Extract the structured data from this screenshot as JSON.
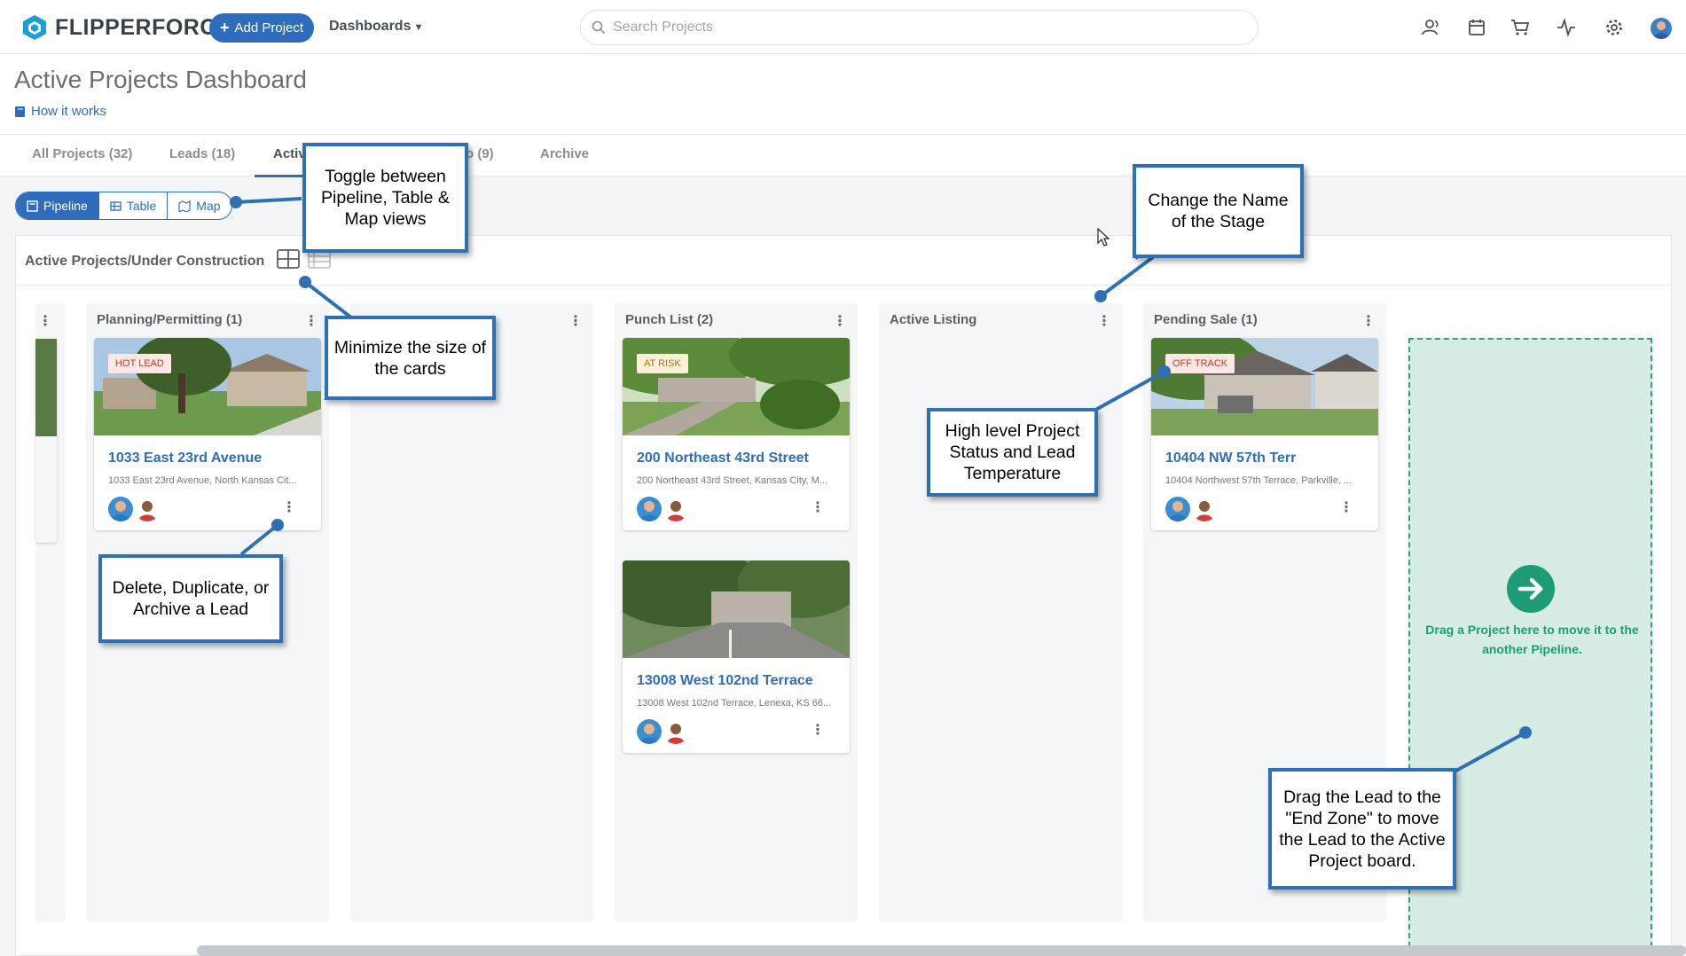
{
  "brand": {
    "name": "FLIPPERFORCE"
  },
  "nav": {
    "add_project": "Add Project",
    "dashboards": "Dashboards",
    "search_placeholder": "Search Projects"
  },
  "page": {
    "title": "Active Projects Dashboard",
    "how_it_works": "How it works"
  },
  "tabs": [
    {
      "label": "All Projects (32)"
    },
    {
      "label": "Leads (18)"
    },
    {
      "label": "Activ"
    },
    {
      "label": "o (9)"
    },
    {
      "label": "Archive"
    }
  ],
  "views": [
    {
      "label": "Pipeline",
      "active": true
    },
    {
      "label": "Table",
      "active": false
    },
    {
      "label": "Map",
      "active": false
    }
  ],
  "board": {
    "title": "Active Projects/Under Construction",
    "columns": [
      {
        "name": "Planning/Permitting (1)"
      },
      {
        "name": ""
      },
      {
        "name": "Punch List (2)"
      },
      {
        "name": "Active Listing"
      },
      {
        "name": "Pending Sale (1)"
      }
    ],
    "cards": [
      {
        "badge": "HOT LEAD",
        "title": "1033 East 23rd Avenue",
        "address": "1033 East 23rd Avenue, North Kansas Cit..."
      },
      {
        "badge": "AT RISK",
        "title": "200 Northeast 43rd Street",
        "address": "200 Northeast 43rd Street, Kansas City, M..."
      },
      {
        "badge": "",
        "title": "13008 West 102nd Terrace",
        "address": "13008 West 102nd Terrace, Lenexa, KS 66..."
      },
      {
        "badge": "OFF TRACK",
        "title": "10404 NW 57th Terr",
        "address": "10404 Northwest 57th Terrace, Parkville, ..."
      }
    ],
    "end_zone_text": "Drag a Project here to move it to the another Pipeline."
  },
  "callouts": {
    "toggle": "Toggle between Pipeline, Table & Map views",
    "minimize": "Minimize the size of the cards",
    "rename": "Change the Name of the Stage",
    "status": "High level Project Status and Lead Temperature",
    "delete": "Delete, Duplicate, or Archive a Lead",
    "endzone": "Drag the Lead to the \"End Zone\" to move the Lead to the Active Project board."
  },
  "colors": {
    "brand_blue": "#2e6dbb",
    "callout_border": "#2f6fb3",
    "end_zone_green": "#1d9c76",
    "hot_lead_text": "#c0392b",
    "at_risk_text": "#a8741a"
  },
  "icons": [
    "search-icon",
    "users-icon",
    "calendar-icon",
    "cart-icon",
    "activity-icon",
    "gear-icon",
    "book-icon",
    "kebab-menu-icon",
    "arrow-right-icon"
  ]
}
